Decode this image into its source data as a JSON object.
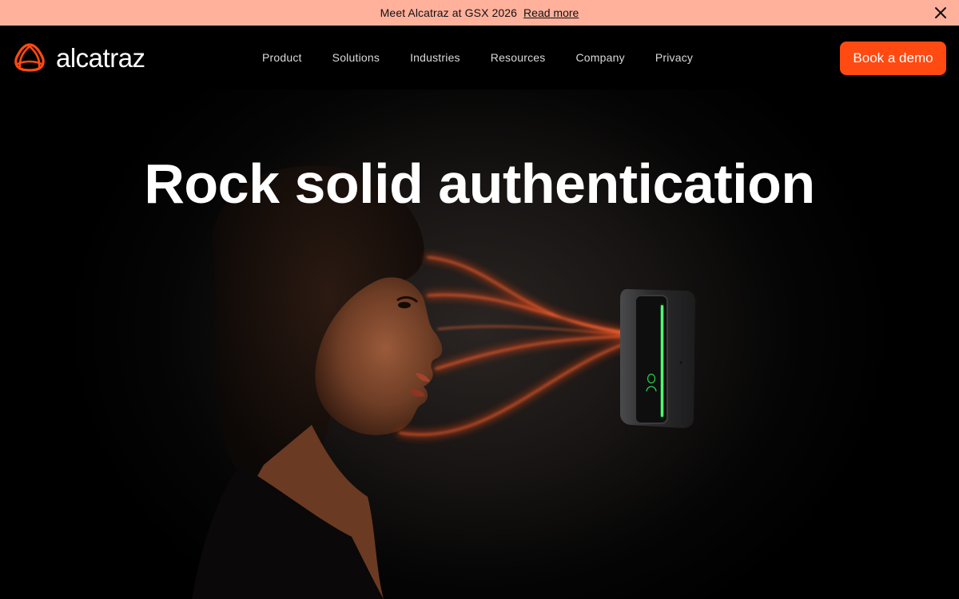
{
  "announcement": {
    "message": "Meet Alcatraz at GSX 2026",
    "link_label": "Read more",
    "close_icon": "close-icon"
  },
  "nav": {
    "logo_icon": "alcatraz-logo-icon",
    "brand": "alcatraz",
    "items": [
      {
        "label": "Product"
      },
      {
        "label": "Solutions"
      },
      {
        "label": "Industries"
      },
      {
        "label": "Resources"
      },
      {
        "label": "Company"
      },
      {
        "label": "Privacy"
      }
    ],
    "cta_label": "Book a demo"
  },
  "hero": {
    "headline": "Rock solid authentication",
    "image_description_icon": "face-scan-device-icon"
  },
  "colors": {
    "accent": "#ff4a12",
    "announcement_bg": "#ffb19c",
    "background": "#000000",
    "device_led": "#22d14a"
  }
}
